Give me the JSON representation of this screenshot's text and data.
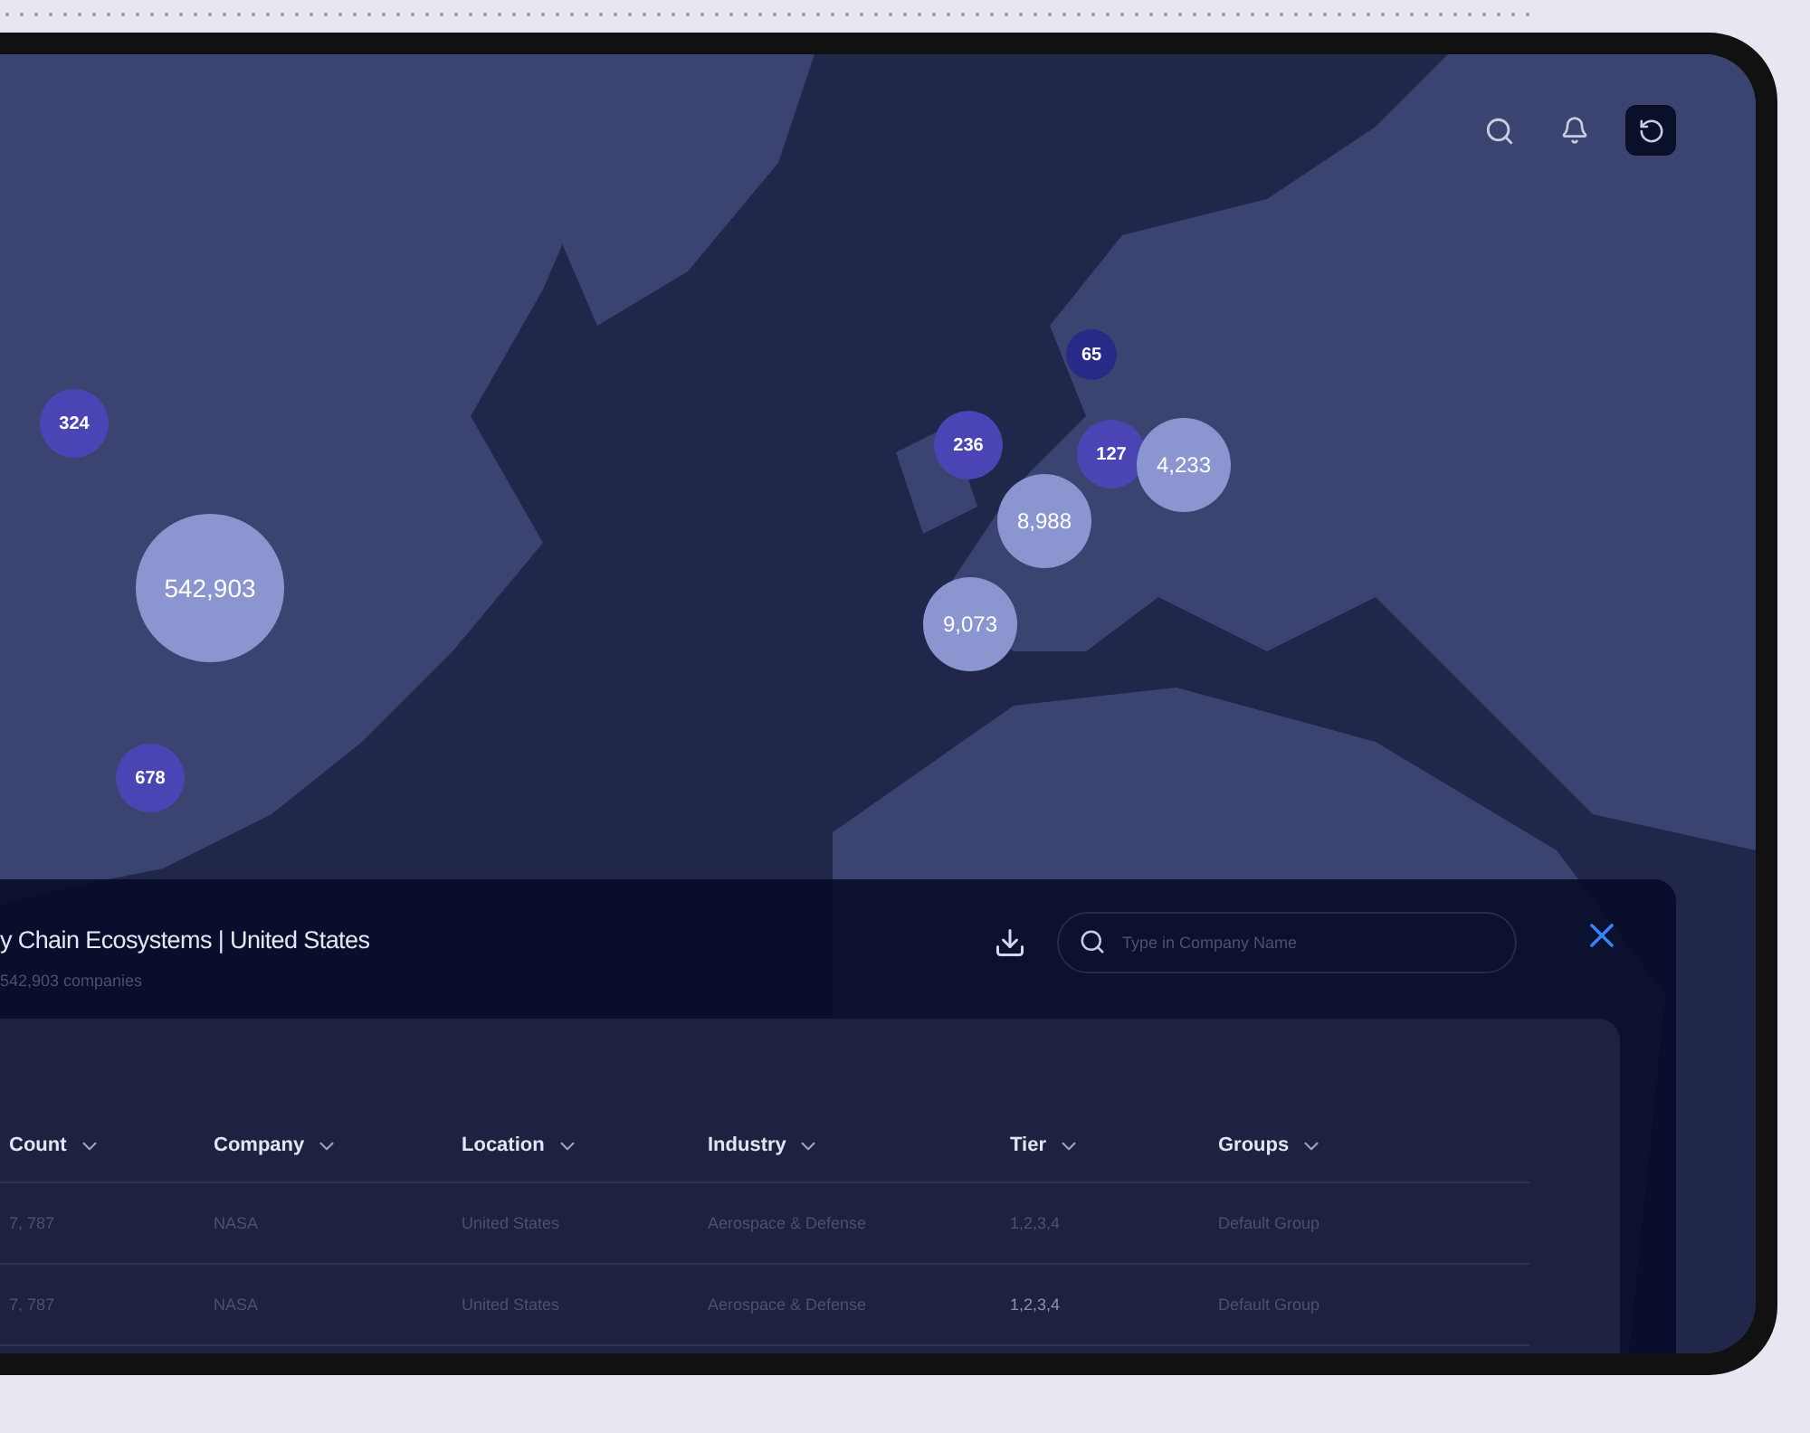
{
  "markers": [
    {
      "label": "324",
      "color": "#4b44b5"
    },
    {
      "label": "542,903",
      "color": "#8b95cf"
    },
    {
      "label": "678",
      "color": "#4b44b5"
    },
    {
      "label": "236",
      "color": "#4b44b5"
    },
    {
      "label": "65",
      "color": "#272a86"
    },
    {
      "label": "127",
      "color": "#4b44b5"
    },
    {
      "label": "4,233",
      "color": "#8b95cf"
    },
    {
      "label": "8,988",
      "color": "#8b95cf"
    },
    {
      "label": "9,073",
      "color": "#8b95cf"
    }
  ],
  "panel": {
    "title": "y Chain Ecosystems | United States",
    "subtitle": "542,903 companies",
    "search": {
      "placeholder": "Type in Company Name"
    },
    "table": {
      "columns": [
        "Count",
        "Company",
        "Location",
        "Industry",
        "Tier",
        "Groups"
      ],
      "rows": [
        [
          "7, 787",
          "NASA",
          "United States",
          "Aerospace & Defense",
          "1,2,3,4",
          "Default Group"
        ],
        [
          "7, 787",
          "NASA",
          "United States",
          "Aerospace & Defense",
          "1,2,3,4",
          "Default Group"
        ]
      ]
    }
  }
}
